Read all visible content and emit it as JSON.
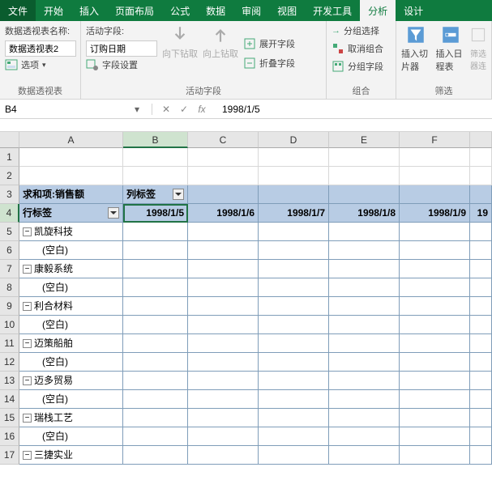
{
  "tabs": [
    "文件",
    "开始",
    "插入",
    "页面布局",
    "公式",
    "数据",
    "审阅",
    "视图",
    "开发工具",
    "分析",
    "设计"
  ],
  "active_tab": 9,
  "ribbon": {
    "g1": {
      "name_label": "数据透视表名称:",
      "name_value": "数据透视表2",
      "options": "选项",
      "label": "数据透视表"
    },
    "g2": {
      "field_label": "活动字段:",
      "field_value": "订购日期",
      "settings": "字段设置",
      "drill_down": "向下钻取",
      "drill_up": "向上钻取",
      "expand": "展开字段",
      "collapse": "折叠字段",
      "label": "活动字段"
    },
    "g3": {
      "sel": "分组选择",
      "ungroup": "取消组合",
      "field": "分组字段",
      "label": "组合"
    },
    "g4": {
      "slicer": "插入切片器",
      "timeline": "插入日程表",
      "conn": "筛选器连",
      "label": "筛选"
    }
  },
  "fbar": {
    "cell": "B4",
    "formula": "1998/1/5",
    "cancel": "✕",
    "confirm": "✓",
    "fx": "fx"
  },
  "cols": [
    "A",
    "B",
    "C",
    "D",
    "E",
    "F",
    ""
  ],
  "colw": [
    "wA",
    "wB",
    "wC",
    "wD",
    "wE",
    "wF",
    "wG"
  ],
  "rows": [
    [
      "",
      "",
      "",
      "",
      "",
      "",
      ""
    ],
    [
      "",
      "",
      "",
      "",
      "",
      "",
      ""
    ],
    [
      "求和项:销售额",
      "列标签",
      "",
      "",
      "",
      "",
      ""
    ],
    [
      "行标签",
      "1998/1/5",
      "1998/1/6",
      "1998/1/7",
      "1998/1/8",
      "1998/1/9",
      "19"
    ],
    [
      "凯旋科技",
      "",
      "",
      "",
      "",
      "",
      ""
    ],
    [
      "(空白)",
      "",
      "",
      "",
      "",
      "",
      ""
    ],
    [
      "康毅系统",
      "",
      "",
      "",
      "",
      "",
      ""
    ],
    [
      "(空白)",
      "",
      "",
      "",
      "",
      "",
      ""
    ],
    [
      "利合材料",
      "",
      "",
      "",
      "",
      "",
      ""
    ],
    [
      "(空白)",
      "",
      "",
      "",
      "",
      "",
      ""
    ],
    [
      "迈策船舶",
      "",
      "",
      "",
      "",
      "",
      ""
    ],
    [
      "(空白)",
      "",
      "",
      "",
      "",
      "",
      ""
    ],
    [
      "迈多贸易",
      "",
      "",
      "",
      "",
      "",
      ""
    ],
    [
      "(空白)",
      "",
      "",
      "",
      "",
      "",
      ""
    ],
    [
      "瑞栈工艺",
      "",
      "",
      "",
      "",
      "",
      ""
    ],
    [
      "(空白)",
      "",
      "",
      "",
      "",
      "",
      ""
    ],
    [
      "三捷实业",
      "",
      "",
      "",
      "",
      "",
      ""
    ]
  ],
  "collapse_sym": "−"
}
